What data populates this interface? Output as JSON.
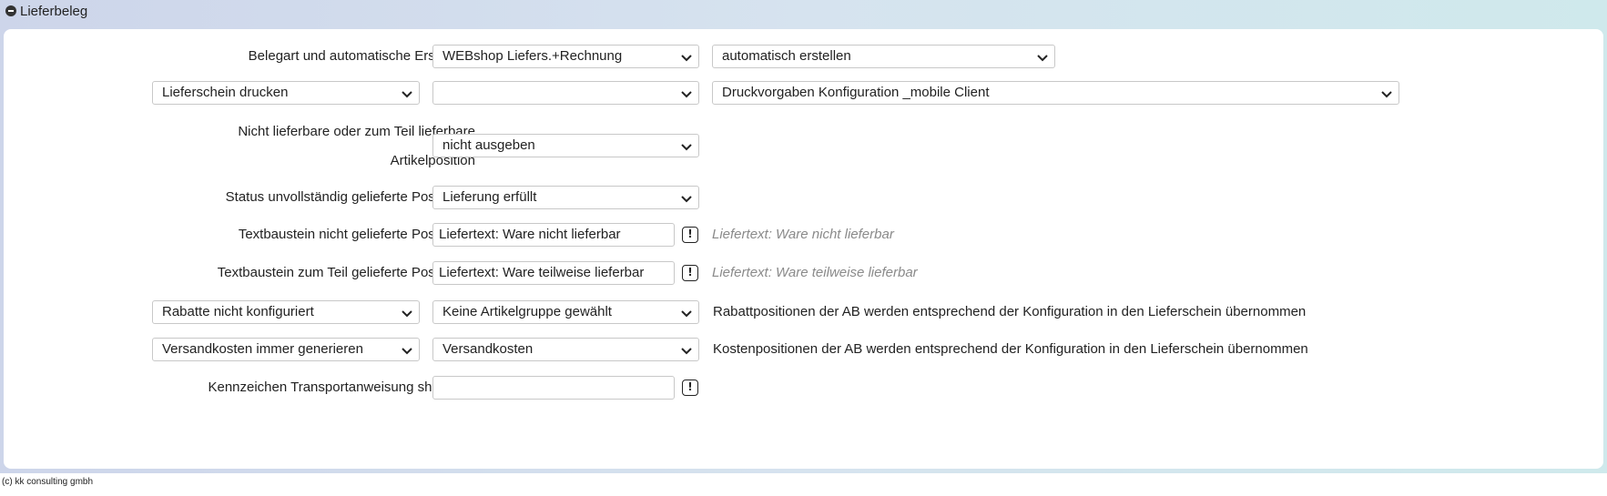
{
  "section": {
    "title": "Lieferbeleg"
  },
  "rows": {
    "belegart": {
      "label": "Belegart und automatische Erstellung",
      "select1": "WEBshop Liefers.+Rechnung",
      "select2": "automatisch erstellen"
    },
    "druck": {
      "select0": "Lieferschein drucken",
      "select1": "",
      "select2": "Druckvorgaben Konfiguration _mobile Client"
    },
    "nichtlieferbar": {
      "label_line1": "Nicht lieferbare oder zum Teil lieferbare",
      "label_line2": "Artikelposition",
      "select1": "nicht ausgeben"
    },
    "status": {
      "label": "Status unvollständig gelieferte Positionen",
      "select1": "Lieferung erfüllt"
    },
    "textbaustein_nicht": {
      "label": "Textbaustein nicht gelieferte Positionen",
      "value": "Liefertext: Ware nicht lieferbar",
      "button": "!",
      "hint": "Liefertext: Ware nicht lieferbar"
    },
    "textbaustein_teil": {
      "label": "Textbaustein zum Teil gelieferte Positionen",
      "value": "Liefertext: Ware teilweise lieferbar",
      "button": "!",
      "hint": "Liefertext: Ware teilweise lieferbar"
    },
    "rabatte": {
      "select0": "Rabatte nicht konfiguriert",
      "select1": "Keine Artikelgruppe gewählt",
      "note": "Rabattpositionen der AB werden entsprechend der Konfiguration in den Lieferschein übernommen"
    },
    "versand": {
      "select0": "Versandkosten immer generieren",
      "select1": "Versandkosten",
      "note": "Kostenpositionen der AB werden entsprechend der Konfiguration in den Lieferschein übernommen"
    },
    "kennzeichen": {
      "label": "Kennzeichen Transportanweisung shipXpert",
      "value": "",
      "button": "!"
    }
  },
  "footer": {
    "text": "(c) kk consulting gmbh"
  }
}
